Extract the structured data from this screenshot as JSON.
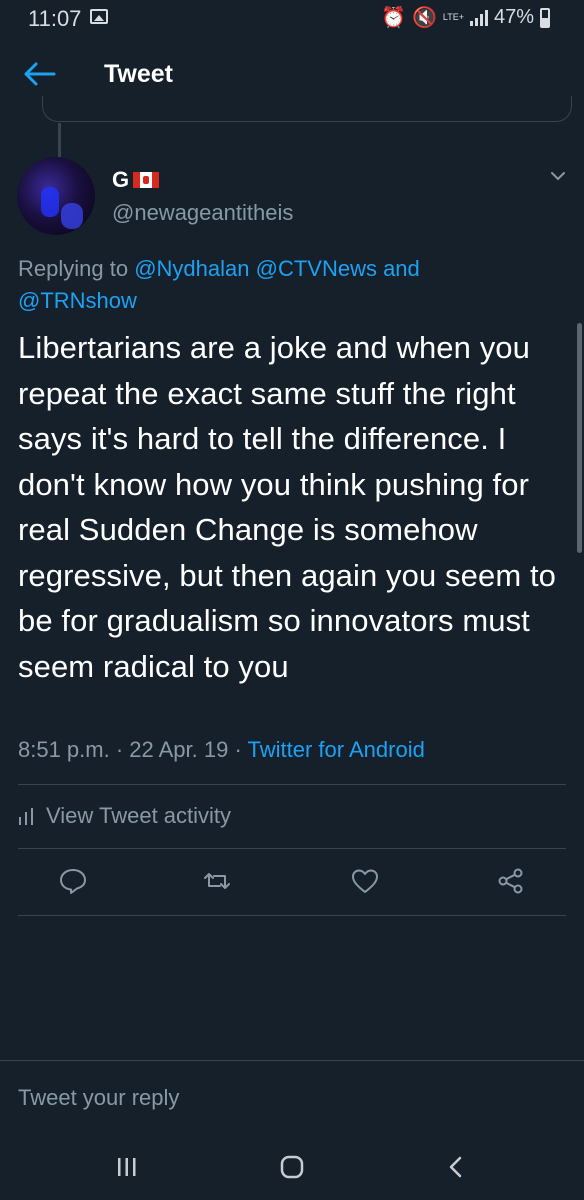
{
  "status_bar": {
    "time": "11:07",
    "network": "LTE+",
    "battery": "47%"
  },
  "header": {
    "title": "Tweet"
  },
  "tweet": {
    "author_name": "G",
    "handle": "@newageantitheis",
    "replying_prefix": "Replying to ",
    "replying_to_1": "@Nydhalan",
    "replying_to_2": "@CTVNews",
    "replying_and": " and",
    "replying_to_3": "@TRNshow",
    "text": "Libertarians are a joke and when you repeat the exact same stuff the right says it's hard to tell the difference. I don't know how you think pushing for real Sudden Change is somehow regressive, but then again you seem to be for gradualism so innovators must seem radical to you",
    "timestamp": "8:51 p.m. · 22 Apr. 19 · ",
    "source": "Twitter for Android"
  },
  "activity": {
    "label": "View Tweet activity"
  },
  "reply": {
    "placeholder": "Tweet your reply"
  },
  "colors": {
    "background": "#15202b",
    "accent": "#1da1f2",
    "muted": "#8899a6",
    "divider": "#38444d"
  },
  "icons": [
    "back-arrow-icon",
    "chevron-down-icon",
    "reply-icon",
    "retweet-icon",
    "like-icon",
    "share-icon",
    "bar-chart-icon",
    "recents-nav-icon",
    "home-nav-icon",
    "back-nav-icon"
  ]
}
